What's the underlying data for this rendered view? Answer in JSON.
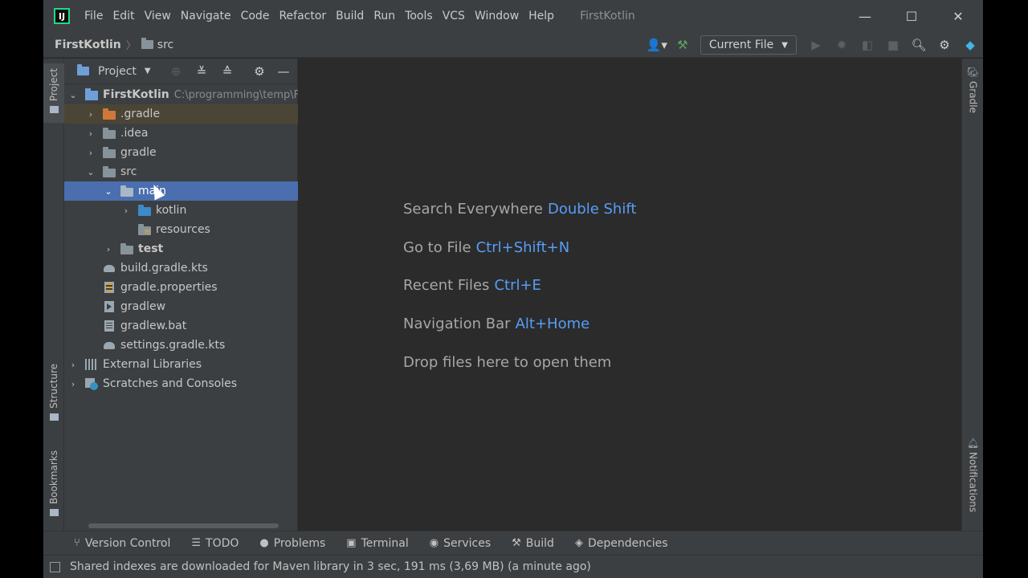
{
  "app": {
    "logo_text": "IJ",
    "project_name": "FirstKotlin"
  },
  "menu": [
    "File",
    "Edit",
    "View",
    "Navigate",
    "Code",
    "Refactor",
    "Build",
    "Run",
    "Tools",
    "VCS",
    "Window",
    "Help"
  ],
  "window_controls": {
    "minimize": "—",
    "maximize": "☐",
    "close": "✕"
  },
  "breadcrumb": {
    "project": "FirstKotlin",
    "folder": "src"
  },
  "toolbar": {
    "run_config": "Current File"
  },
  "project_panel": {
    "title": "Project",
    "tree": [
      {
        "label": "FirstKotlin",
        "hint": "C:\\programming\\temp\\F",
        "expanded": true
      },
      {
        "label": ".gradle",
        "expanded": false
      },
      {
        "label": ".idea",
        "expanded": false
      },
      {
        "label": "gradle",
        "expanded": false
      },
      {
        "label": "src",
        "expanded": true
      },
      {
        "label": "main",
        "expanded": true,
        "selected": true
      },
      {
        "label": "kotlin",
        "expanded": false
      },
      {
        "label": "resources"
      },
      {
        "label": "test",
        "expanded": false
      },
      {
        "label": "build.gradle.kts"
      },
      {
        "label": "gradle.properties"
      },
      {
        "label": "gradlew"
      },
      {
        "label": "gradlew.bat"
      },
      {
        "label": "settings.gradle.kts"
      },
      {
        "label": "External Libraries",
        "expanded": false
      },
      {
        "label": "Scratches and Consoles",
        "expanded": false
      }
    ]
  },
  "side_tabs": {
    "left": [
      "Project",
      "Structure",
      "Bookmarks"
    ],
    "right": [
      "Gradle",
      "Notifications"
    ]
  },
  "editor_hints": [
    {
      "text": "Search Everywhere",
      "key": "Double Shift"
    },
    {
      "text": "Go to File",
      "key": "Ctrl+Shift+N"
    },
    {
      "text": "Recent Files",
      "key": "Ctrl+E"
    },
    {
      "text": "Navigation Bar",
      "key": "Alt+Home"
    },
    {
      "text": "Drop files here to open them",
      "key": ""
    }
  ],
  "bottom_tabs": [
    "Version Control",
    "TODO",
    "Problems",
    "Terminal",
    "Services",
    "Build",
    "Dependencies"
  ],
  "status": {
    "text": "Shared indexes are downloaded for Maven library in 3 sec, 191 ms (3,69 MB) (a minute ago)"
  },
  "colors": {
    "accent_selection": "#4b6eaf",
    "shortcut_blue": "#589df6",
    "panel_bg": "#3c3f41",
    "editor_bg": "#2b2b2b"
  }
}
